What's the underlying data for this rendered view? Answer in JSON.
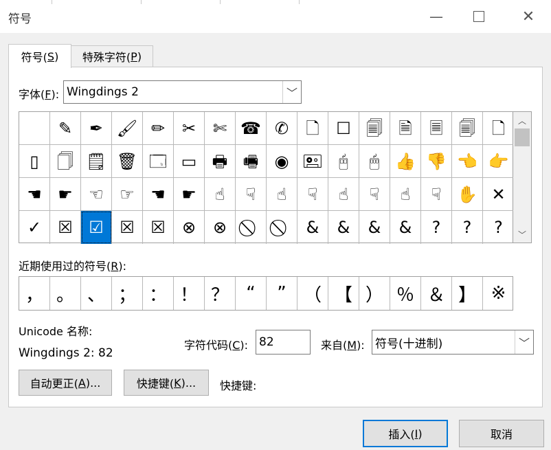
{
  "window": {
    "title": "符号",
    "minimize_icon": "minimize-icon",
    "maximize_icon": "maximize-icon",
    "close_icon": "close-icon"
  },
  "tabs": [
    {
      "label": "符号(",
      "key": "S",
      "suffix": ")"
    },
    {
      "label": "特殊字符(",
      "key": "P",
      "suffix": ")"
    }
  ],
  "font": {
    "label": "字体(",
    "key": "F",
    "suffix": "):",
    "value": "Wingdings 2"
  },
  "grid": {
    "rows": [
      [
        "",
        "✎",
        "✒",
        "🖌",
        "✏",
        "✂",
        "✄",
        "☎",
        "✆",
        "🗋",
        "☐",
        "🗐",
        "🗎",
        "🗏",
        "🗐",
        "🗋"
      ],
      [
        "▯",
        "🗍",
        "🗒",
        "🗑",
        "🗔",
        "▭",
        "🖶",
        "🖷",
        "◉",
        "🖭",
        "🖰",
        "🖱",
        "👍",
        "👎",
        "👈",
        "👉"
      ],
      [
        "☚",
        "☛",
        "☜",
        "☞",
        "☚",
        "☛",
        "☝",
        "☟",
        "☝",
        "☟",
        "☝",
        "☟",
        "☝",
        "☟",
        "✋",
        "✕"
      ],
      [
        "✓",
        "☒",
        "☑",
        "☒",
        "☒",
        "⊗",
        "⊗",
        "⃠",
        "⃠",
        "&",
        "&",
        "&",
        "&",
        "?",
        "?",
        "?"
      ]
    ],
    "selected_row": 3,
    "selected_col": 2
  },
  "recent": {
    "label": "近期使用过的符号(",
    "key": "R",
    "suffix": "):",
    "symbols": [
      "，",
      "。",
      "、",
      "；",
      "：",
      "！",
      "？",
      "“",
      "”",
      "（",
      "【",
      "）",
      "％",
      "＆",
      "】",
      "※"
    ]
  },
  "unicode": {
    "label": "Unicode 名称:",
    "value": "Wingdings 2: 82"
  },
  "char_code": {
    "label": "字符代码(",
    "key": "C",
    "suffix": "):",
    "value": "82"
  },
  "from": {
    "label": "来自(",
    "key": "M",
    "suffix": "):",
    "value": "符号(十进制)"
  },
  "buttons": {
    "autocorrect": {
      "label": "自动更正(",
      "key": "A",
      "suffix": ")..."
    },
    "shortcut": {
      "label": "快捷键(",
      "key": "K",
      "suffix": ")..."
    },
    "shortcut_label": "快捷键:",
    "insert": {
      "label": "插入(",
      "key": "I",
      "suffix": ")"
    },
    "cancel": "取消"
  }
}
